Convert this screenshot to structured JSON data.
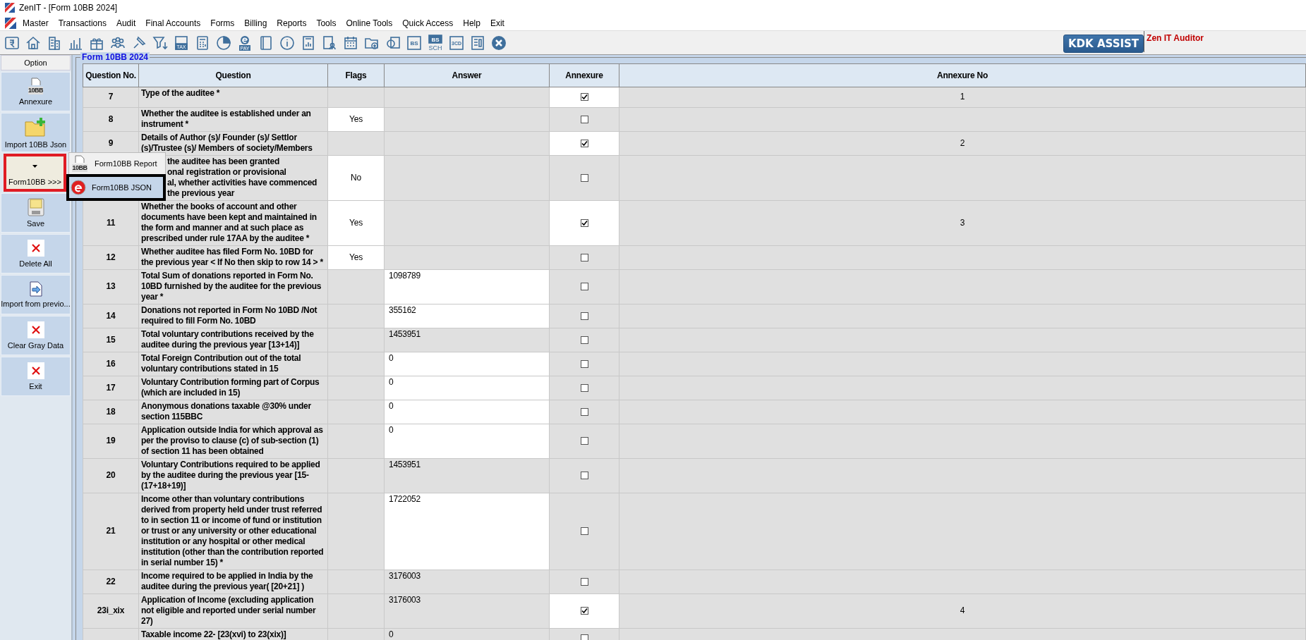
{
  "window": {
    "title": "ZenIT - [Form 10BB 2024]"
  },
  "menu_bar": [
    "Master",
    "Transactions",
    "Audit",
    "Final Accounts",
    "Forms",
    "Billing",
    "Reports",
    "Tools",
    "Online Tools",
    "Quick Access",
    "Help",
    "Exit"
  ],
  "toolbar": [
    {
      "kind": "rupee"
    },
    {
      "kind": "home"
    },
    {
      "kind": "building"
    },
    {
      "kind": "chart"
    },
    {
      "kind": "gift"
    },
    {
      "kind": "people"
    },
    {
      "kind": "pin"
    },
    {
      "kind": "filter"
    },
    {
      "kind": "tag",
      "label": "TAX"
    },
    {
      "kind": "calculator"
    },
    {
      "kind": "pie"
    },
    {
      "kind": "epay",
      "label": "PAY"
    },
    {
      "kind": "book"
    },
    {
      "kind": "info"
    },
    {
      "kind": "report"
    },
    {
      "kind": "user-doc"
    },
    {
      "kind": "calendar"
    },
    {
      "kind": "folder-plus"
    },
    {
      "kind": "search-doc"
    },
    {
      "kind": "box-text",
      "label": "BS"
    },
    {
      "kind": "bs-sch",
      "label": "BS",
      "sublabel": "SCH"
    },
    {
      "kind": "box-text",
      "label": "3CD"
    },
    {
      "kind": "form"
    },
    {
      "kind": "close"
    }
  ],
  "kdk_button": "KDK ASSIST",
  "product": "Zen IT Auditor",
  "sidebar": {
    "header": "Option",
    "items": [
      {
        "kind": "doc",
        "icon_text": "10BB",
        "label": "Annexure",
        "selected": false
      },
      {
        "kind": "folder-plus",
        "label": "Import 10BB Json",
        "selected": false
      },
      {
        "kind": "dropdown",
        "label": "Form10BB >>>",
        "selected": true
      },
      {
        "kind": "save",
        "label": "Save",
        "selected": false
      },
      {
        "kind": "delete",
        "label": "Delete All",
        "selected": false
      },
      {
        "kind": "import",
        "label": "Import from previo...",
        "selected": false
      },
      {
        "kind": "delete",
        "label": "Clear Gray Data",
        "selected": false
      },
      {
        "kind": "delete",
        "label": "Exit",
        "selected": false
      }
    ]
  },
  "popup_menu": [
    {
      "kind": "doc",
      "icon_text": "10BB",
      "label": "Form10BB Report",
      "selected": false
    },
    {
      "kind": "e",
      "label": "Form10BB JSON",
      "selected": true
    }
  ],
  "form": {
    "title": "Form 10BB 2024",
    "columns": [
      "Question No.",
      "Question",
      "Flags",
      "Answer",
      "Annexure",
      "Annexure No"
    ],
    "rows": [
      {
        "no": "7",
        "question": "Type of the auditee *",
        "flag_editable": false,
        "answer_editable": false,
        "annexure": true,
        "annexure_no": "1"
      },
      {
        "no": "8",
        "question": "Whether the auditee is established under an instrument *",
        "flag": "Yes",
        "flag_editable": true,
        "answer_editable": false,
        "annexure": false
      },
      {
        "no": "9",
        "question": "Details of Author (s)/ Founder (s)/ Settlor (s)/Trustee (s)/ Members of society/Members",
        "flag_editable": false,
        "answer_editable": false,
        "annexure": true,
        "annexure_no": "2"
      },
      {
        "covered": true,
        "question": "the auditee has been granted\nonal registration or provisional\nal, whether activities have commenced\nthe previous year",
        "flag": "No",
        "flag_editable": true,
        "answer_editable": false,
        "annexure": false
      },
      {
        "no": "11",
        "question": "Whether the books of account and other documents have been kept and maintained in the form and manner and at such place as prescribed under rule 17AA by the auditee *",
        "flag": "Yes",
        "flag_editable": true,
        "answer_editable": false,
        "annexure": true,
        "annexure_no": "3"
      },
      {
        "no": "12",
        "question": "Whether auditee has filed Form No. 10BD for the previous year  < If No then skip to row 14 > *",
        "flag": "Yes",
        "flag_editable": true,
        "answer_editable": false,
        "annexure": false
      },
      {
        "no": "13",
        "question": "Total Sum of donations reported in Form No. 10BD furnished by the auditee for the previous year *",
        "flag_editable": false,
        "answer": "1098789",
        "answer_editable": true,
        "annexure": false
      },
      {
        "no": "14",
        "question": "Donations not reported in Form No 10BD /Not required to fill Form No. 10BD",
        "flag_editable": false,
        "answer": "355162",
        "answer_editable": true,
        "annexure": false
      },
      {
        "no": "15",
        "question": "Total voluntary contributions received by the auditee during the previous year [13+14)]",
        "flag_editable": false,
        "answer": "1453951",
        "answer_editable": false,
        "annexure": false
      },
      {
        "no": "16",
        "question": "Total Foreign Contribution out of the total voluntary contributions stated in 15",
        "flag_editable": false,
        "answer": "0",
        "answer_editable": true,
        "annexure": false
      },
      {
        "no": "17",
        "question": "Voluntary Contribution forming part of Corpus (which are included in 15)",
        "flag_editable": false,
        "answer": "0",
        "answer_editable": true,
        "annexure": false
      },
      {
        "no": "18",
        "question": "Anonymous donations taxable @30% under section 115BBC",
        "flag_editable": false,
        "answer": "0",
        "answer_editable": true,
        "annexure": false
      },
      {
        "no": "19",
        "question": "Application outside India for which approval as per the proviso to clause (c) of sub-section (1) of section 11 has been obtained",
        "flag_editable": false,
        "answer": "0",
        "answer_editable": true,
        "annexure": false
      },
      {
        "no": "20",
        "question": "Voluntary Contributions required to be applied by the auditee during the previous year [15-(17+18+19)]",
        "flag_editable": false,
        "answer": "1453951",
        "answer_editable": false,
        "annexure": false
      },
      {
        "no": "21",
        "question": "Income other than voluntary contributions derived from property held under trust referred to in section 11 or income of fund or institution or trust or any university or other educational institution or any hospital or other medical institution (other than the contribution reported in serial number 15) *",
        "flag_editable": false,
        "answer": "1722052",
        "answer_editable": true,
        "annexure": false
      },
      {
        "no": "22",
        "question": "Income required to be applied in India by the auditee during the previous year( [20+21] )",
        "flag_editable": false,
        "answer": "3176003",
        "answer_editable": false,
        "annexure": false
      },
      {
        "no": "23i_xix",
        "question": "Application of Income (excluding application not eligible and reported under serial number 27)",
        "flag_editable": false,
        "answer": "3176003",
        "answer_editable": false,
        "annexure": true,
        "annexure_no": "4"
      },
      {
        "question": "Taxable income 22- [23(xvi) to 23(xix)]",
        "flag_editable": false,
        "answer": "0",
        "answer_editable": false,
        "annexure": false
      }
    ]
  }
}
